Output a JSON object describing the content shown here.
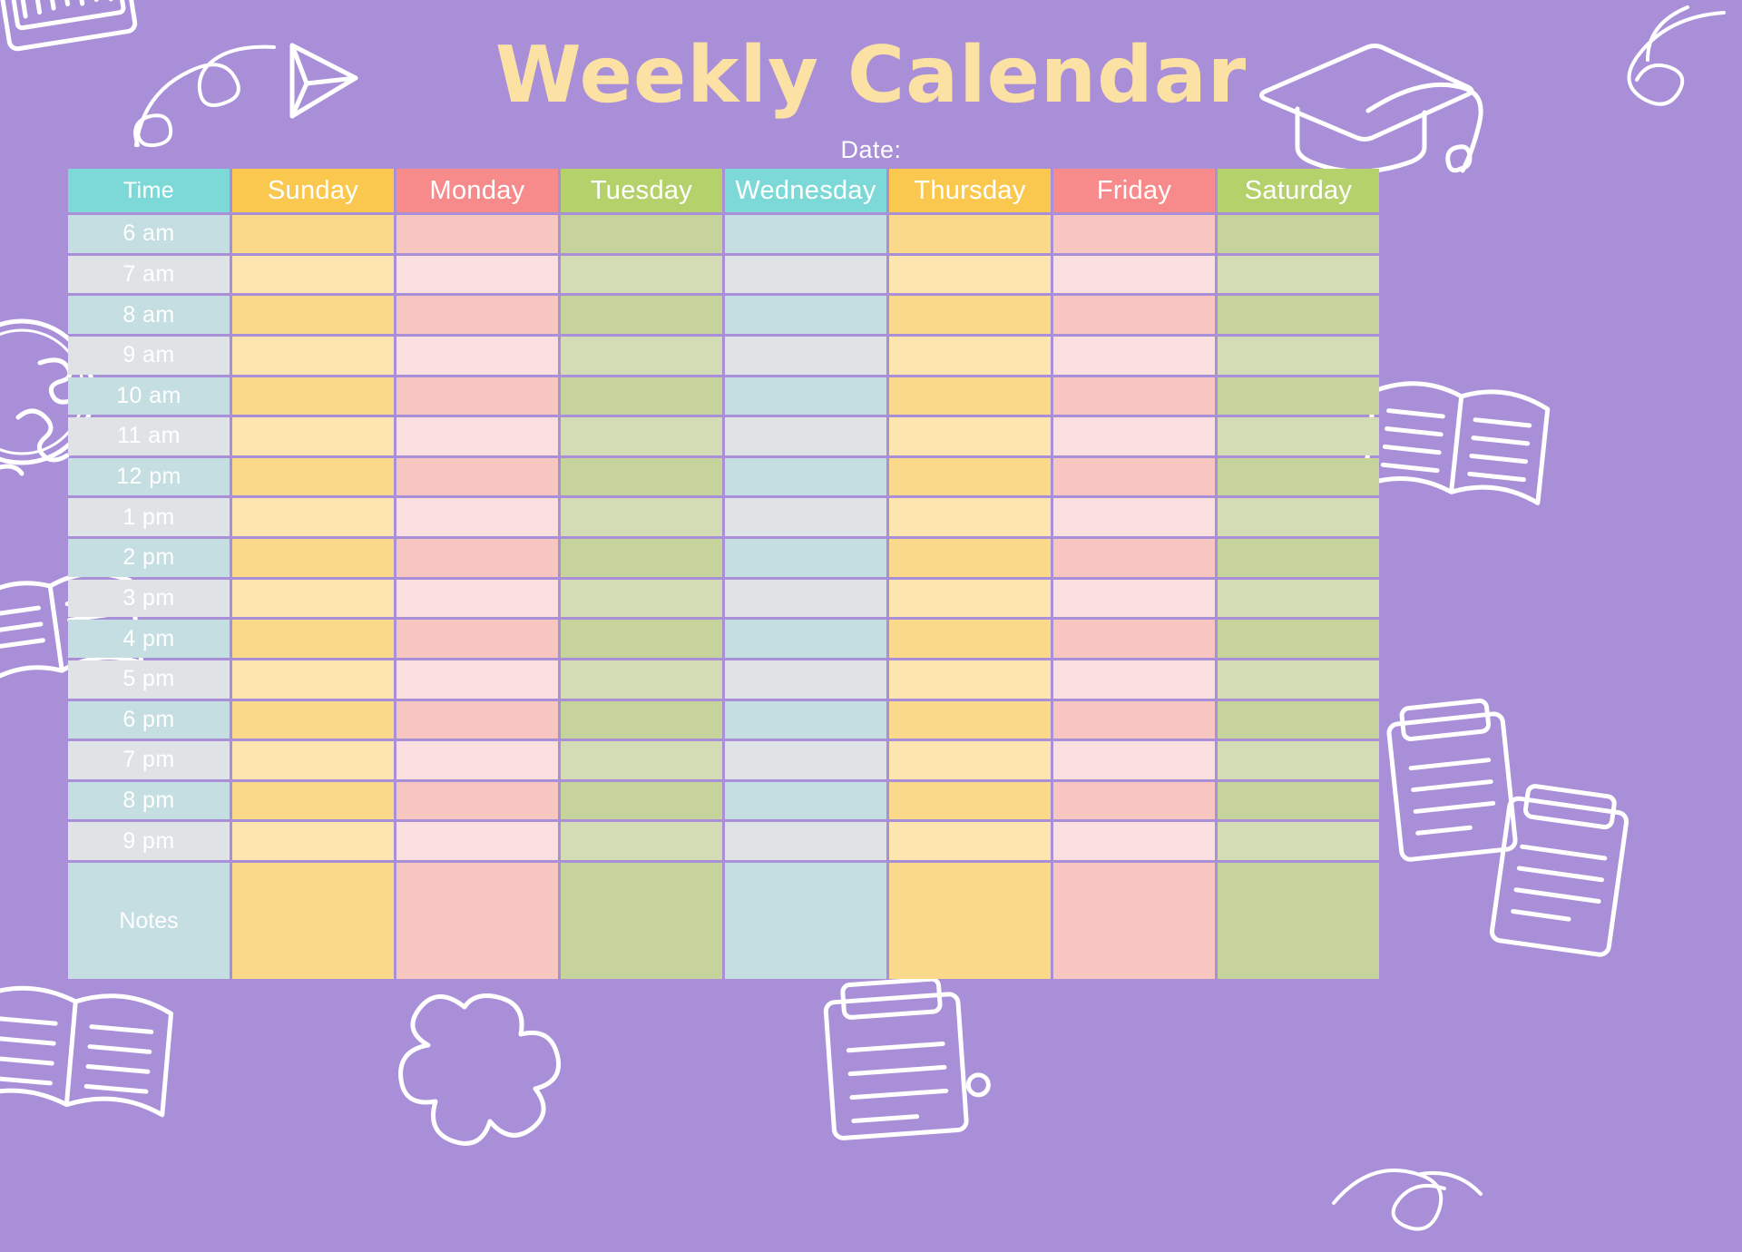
{
  "page": {
    "title": "Weekly Calendar",
    "date_label": "Date:",
    "background_color": "#a98fd8",
    "title_color": "#fbe2a4",
    "grid_line_color": "#ffffff"
  },
  "calendar": {
    "columns": [
      {
        "key": "time",
        "label": "Time",
        "header_color": "#7cd9d8",
        "cell_odd": "#c5dee2",
        "cell_even": "#dfe3e6"
      },
      {
        "key": "sunday",
        "label": "Sunday",
        "header_color": "#fbc84f",
        "cell_odd": "#fad98b",
        "cell_even": "#fce5ae"
      },
      {
        "key": "monday",
        "label": "Monday",
        "header_color": "#f78a8a",
        "cell_odd": "#f7c6c1",
        "cell_even": "#f9dfdf"
      },
      {
        "key": "tuesday",
        "label": "Tuesday",
        "header_color": "#b5d16c",
        "cell_odd": "#c6d49b",
        "cell_even": "#d3dcb5"
      },
      {
        "key": "wednesday",
        "label": "Wednesday",
        "header_color": "#7cd9d8",
        "cell_odd": "#c5dee2",
        "cell_even": "#dfe3e6"
      },
      {
        "key": "thursday",
        "label": "Thursday",
        "header_color": "#fbc84f",
        "cell_odd": "#fad98b",
        "cell_even": "#fce5ae"
      },
      {
        "key": "friday",
        "label": "Friday",
        "header_color": "#f78a8a",
        "cell_odd": "#f7c6c1",
        "cell_even": "#f9dfdf"
      },
      {
        "key": "saturday",
        "label": "Saturday",
        "header_color": "#b5d16c",
        "cell_odd": "#c6d49b",
        "cell_even": "#d3dcb5"
      }
    ],
    "time_slots": [
      "6 am",
      "7 am",
      "8 am",
      "9 am",
      "10 am",
      "11 am",
      "12 pm",
      "1 pm",
      "2 pm",
      "3 pm",
      "4 pm",
      "5 pm",
      "6 pm",
      "7 pm",
      "8 pm",
      "9 pm"
    ],
    "notes_label": "Notes",
    "entries": []
  },
  "decorations": [
    {
      "name": "notebook-doodle",
      "position": "top-left"
    },
    {
      "name": "swirl-doodle",
      "position": "top-left-inner"
    },
    {
      "name": "paper-plane-doodle",
      "position": "top-center-left"
    },
    {
      "name": "graduation-cap-doodle",
      "position": "top-right"
    },
    {
      "name": "swirl-doodle",
      "position": "top-right-corner"
    },
    {
      "name": "globe-doodle",
      "position": "left-upper"
    },
    {
      "name": "open-book-doodle",
      "position": "left-lower"
    },
    {
      "name": "open-book-doodle",
      "position": "right-upper"
    },
    {
      "name": "clipboard-doodle",
      "position": "right-lower"
    },
    {
      "name": "clipboard-doodle",
      "position": "bottom-right"
    },
    {
      "name": "open-book-doodle",
      "position": "bottom-left"
    },
    {
      "name": "pretzel-doodle",
      "position": "bottom-center-left"
    },
    {
      "name": "clipboard-doodle",
      "position": "bottom-center"
    },
    {
      "name": "swirl-doodle",
      "position": "bottom-right-corner"
    }
  ]
}
